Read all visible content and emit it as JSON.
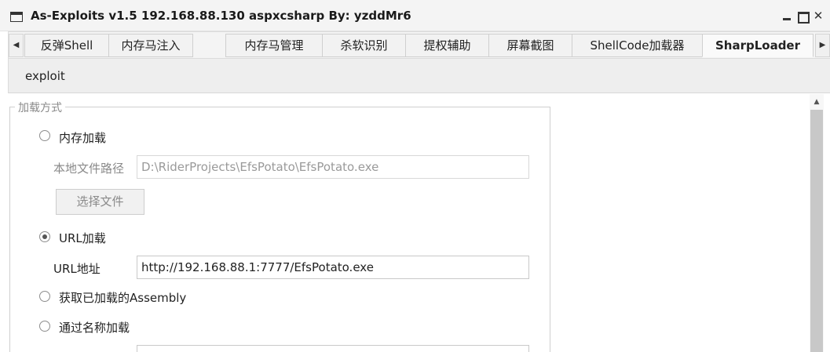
{
  "window": {
    "title": "As-Exploits v1.5 192.168.88.130 aspxcsharp By: yzddMr6",
    "icon": "window-icon",
    "controls": {
      "minimize": "minimize-icon",
      "maximize": "maximize-icon",
      "close": "✕"
    }
  },
  "tabs": [
    {
      "label": "反弹Shell",
      "active": false
    },
    {
      "label": "内存马注入",
      "active": false
    },
    {
      "label": "内存马管理",
      "active": false
    },
    {
      "label": "杀软识别",
      "active": false
    },
    {
      "label": "提权辅助",
      "active": false
    },
    {
      "label": "屏幕截图",
      "active": false
    },
    {
      "label": "ShellCode加载器",
      "active": false
    },
    {
      "label": "SharpLoader",
      "active": true
    }
  ],
  "tab_scroll": {
    "left": "◀",
    "right": "▶"
  },
  "subtabs": [
    {
      "label": "exploit",
      "active": true
    }
  ],
  "load_group": {
    "legend": "加载方式",
    "options": [
      {
        "label": "内存加载",
        "checked": false
      },
      {
        "label": "URL加载",
        "checked": true
      },
      {
        "label": "获取已加载的Assembly",
        "checked": false
      },
      {
        "label": "通过名称加载",
        "checked": false
      }
    ],
    "local_path": {
      "label": "本地文件路径",
      "value": "D:\\RiderProjects\\EfsPotato\\EfsPotato.exe",
      "disabled": true
    },
    "choose_file_button": "选择文件",
    "url": {
      "label": "URL地址",
      "value": "http://192.168.88.1:7777/EfsPotato.exe"
    }
  },
  "scrollbar": {
    "up": "▲"
  },
  "colors": {
    "titlebar_bg": "#f4f4f4",
    "tab_bg": "#f2f2f2",
    "border": "#cfcfcf",
    "disabled_text": "#9a9a9a",
    "scroll_thumb": "#c8c8c8"
  }
}
